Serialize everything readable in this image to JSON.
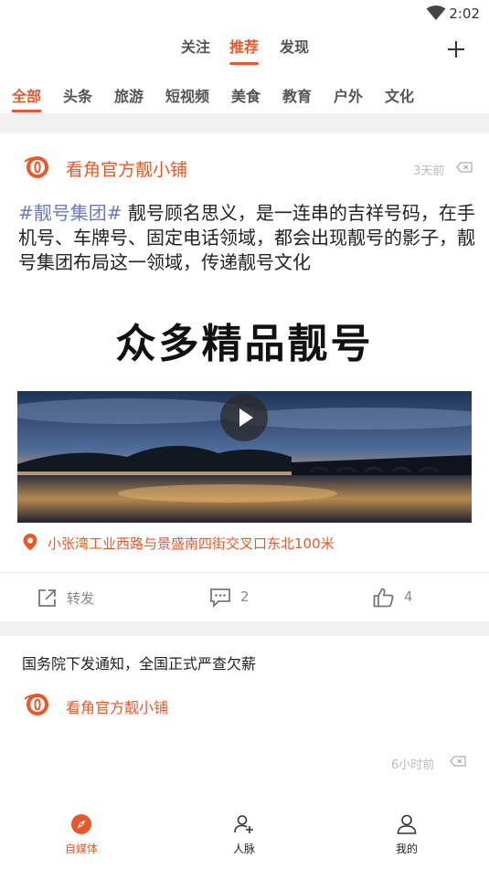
{
  "status_bar": {
    "time": "2:02"
  },
  "top_tabs": [
    {
      "label": "关注",
      "active": false
    },
    {
      "label": "推荐",
      "active": true
    },
    {
      "label": "发现",
      "active": false
    }
  ],
  "categories": [
    {
      "label": "全部",
      "active": true
    },
    {
      "label": "头条",
      "active": false
    },
    {
      "label": "旅游",
      "active": false
    },
    {
      "label": "短视频",
      "active": false
    },
    {
      "label": "美食",
      "active": false
    },
    {
      "label": "教育",
      "active": false
    },
    {
      "label": "户外",
      "active": false
    },
    {
      "label": "文化",
      "active": false
    }
  ],
  "post": {
    "author": "看角官方靓小铺",
    "time": "3天前",
    "hashtag": "#靓号集团#",
    "body": " 靓号顾名思义，是一连串的吉祥号码，在手机号、车牌号、固定电话领域，都会出现靓号的影子，靓号集团布局这一领域，传递靓号文化",
    "video_title": "众多精品靓号",
    "location": "小张湾工业西路与景盛南四街交叉口东北100米",
    "actions": {
      "share_label": "转发",
      "comment_count": "2",
      "like_count": "4"
    }
  },
  "news": {
    "title": "国务院下发通知，全国正式严查欠薪",
    "author": "看角官方靓小铺",
    "time": "6小时前"
  },
  "bottom_nav": [
    {
      "label": "自媒体",
      "icon": "compass-icon",
      "active": true
    },
    {
      "label": "人脉",
      "icon": "add-contact-icon",
      "active": false
    },
    {
      "label": "我的",
      "icon": "profile-icon",
      "active": false
    }
  ],
  "colors": {
    "accent": "#e8582a",
    "hashtag": "#6b7ab8",
    "gap": "#f1f1f1"
  }
}
